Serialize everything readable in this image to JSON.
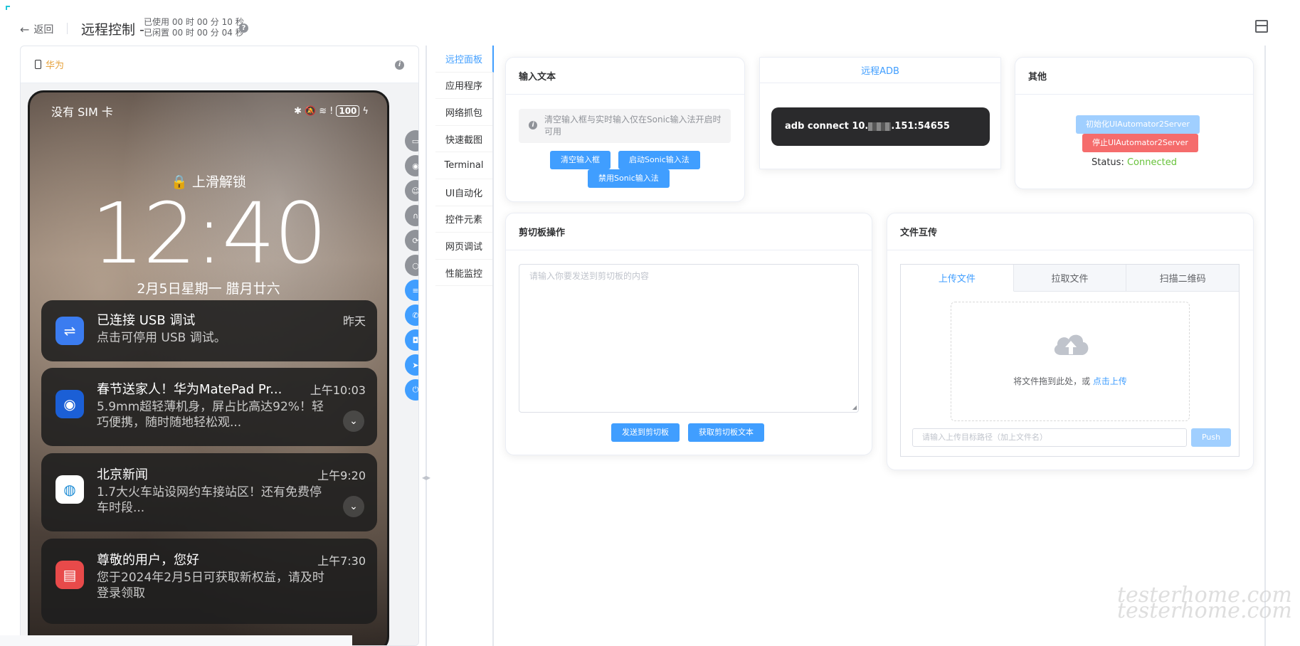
{
  "header": {
    "back_label": "返回",
    "title": "远程控制 -",
    "used_time": "已使用 00 时 00 分 10 秒",
    "idle_time": "已闲置 00 时 00 分 04 秒"
  },
  "device": {
    "brand": "华为",
    "status_carrier": "没有 SIM 卡",
    "battery": "100",
    "lock_hint": "上滑解锁",
    "clock": "12:40",
    "date": "2月5日星期一 腊月廿六"
  },
  "notifications": [
    {
      "title": "已连接 USB 调试",
      "time": "昨天",
      "body": "点击可停用 USB 调试。"
    },
    {
      "title": "春节送家人！华为MatePad Pr...",
      "time": "上午10:03",
      "body": "5.9mm超轻薄机身，屏占比高达92%！轻巧便携，随时随地轻松观..."
    },
    {
      "title": "北京新闻",
      "time": "上午9:20",
      "body": "1.7大火车站设网约车接站区！还有免费停车时段..."
    },
    {
      "title": "尊敬的用户，您好",
      "time": "上午7:30",
      "body": "您于2024年2月5日可获取新权益，请及时登录领取"
    }
  ],
  "side_tabs": [
    "远控面板",
    "应用程序",
    "网络抓包",
    "快速截图",
    "Terminal",
    "UI自动化",
    "控件元素",
    "网页调试",
    "性能监控"
  ],
  "input_text": {
    "title": "输入文本",
    "alert": "清空输入框与实时输入仅在Sonic输入法开启时可用",
    "clear_btn": "清空输入框",
    "enable_btn": "启动Sonic输入法",
    "disable_btn": "禁用Sonic输入法"
  },
  "adb": {
    "title": "远程ADB",
    "command_prefix": "adb connect 10.",
    "command_suffix": ".151:54655"
  },
  "other": {
    "title": "其他",
    "init_btn": "初始化UIAutomator2Server",
    "stop_btn": "停止UIAutomator2Server",
    "status_label": "Status:",
    "status_value": "Connected"
  },
  "clipboard": {
    "title": "剪切板操作",
    "placeholder": "请输入你要发送到剪切板的内容",
    "send_btn": "发送到剪切板",
    "get_btn": "获取剪切板文本"
  },
  "file_transfer": {
    "title": "文件互传",
    "tabs": [
      "上传文件",
      "拉取文件",
      "扫描二维码"
    ],
    "drop_text": "将文件拖到此处，或 ",
    "drop_link": "点击上传",
    "path_placeholder": "请输入上传目标路径（加上文件名）",
    "push_btn": "Push"
  },
  "watermark": "testerhome.com",
  "colors": {
    "primary": "#409eff",
    "danger": "#f56c6c",
    "success": "#67c23a",
    "brand_orange": "#e6a23c"
  }
}
